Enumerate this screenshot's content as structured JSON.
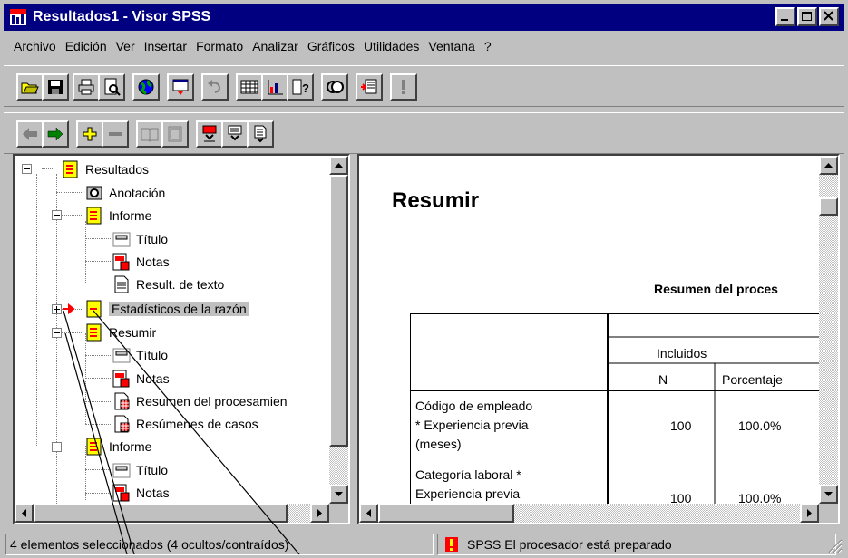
{
  "window": {
    "title": "Resultados1 - Visor SPSS"
  },
  "menu": [
    {
      "label": "Archivo"
    },
    {
      "label": "Edición"
    },
    {
      "label": "Ver"
    },
    {
      "label": "Insertar"
    },
    {
      "label": "Formato"
    },
    {
      "label": "Analizar"
    },
    {
      "label": "Gráficos"
    },
    {
      "label": "Utilidades"
    },
    {
      "label": "Ventana"
    },
    {
      "label": "?"
    }
  ],
  "tree": [
    {
      "label": "Resultados",
      "icon": "output-book-icon"
    },
    {
      "label": "Anotación",
      "icon": "annotation-camera-icon"
    },
    {
      "label": "Informe",
      "icon": "output-book-icon"
    },
    {
      "label": "Título",
      "icon": "title-icon"
    },
    {
      "label": "Notas",
      "icon": "notes-icon"
    },
    {
      "label": "Result. de texto",
      "icon": "text-output-icon"
    },
    {
      "label": "Estadísticos de la razón",
      "icon": "collapsed-book-icon"
    },
    {
      "label": "Resumir",
      "icon": "output-book-icon"
    },
    {
      "label": "Título",
      "icon": "title-icon"
    },
    {
      "label": "Notas",
      "icon": "notes-icon"
    },
    {
      "label": "Resumen del procesamien",
      "icon": "pivot-table-icon"
    },
    {
      "label": "Resúmenes de casos",
      "icon": "pivot-table-icon"
    },
    {
      "label": "Informe",
      "icon": "output-book-icon"
    },
    {
      "label": "Título",
      "icon": "title-icon"
    },
    {
      "label": "Notas",
      "icon": "notes-icon"
    }
  ],
  "content": {
    "heading": "Resumir",
    "table_title": "Resumen del proces",
    "col_group": "Incluidos",
    "col_n": "N",
    "col_pct": "Porcentaje",
    "rows": [
      {
        "l1": "Código de empleado",
        "l2": "* Experiencia previa",
        "l3": "(meses)",
        "n": "100",
        "pct": "100.0%"
      },
      {
        "l1": "Categoría laboral  *",
        "l2": "Experiencia previa",
        "l3": "",
        "n": "100",
        "pct": "100.0%"
      }
    ]
  },
  "status": {
    "left": "4 elementos seleccionados (4 ocultos/contraídos)",
    "right": "SPSS El procesador  está preparado"
  },
  "colors": {
    "titlebar": "#000080",
    "face": "#c0c0c0",
    "book_icon": "#ffff00",
    "accent_red": "#ff0000"
  }
}
